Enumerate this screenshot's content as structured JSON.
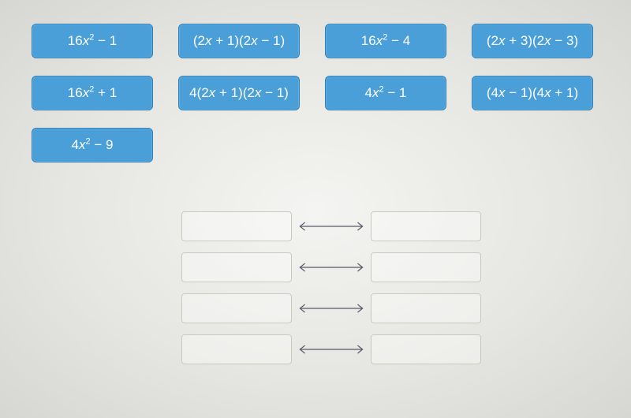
{
  "tiles": {
    "r0c0": {
      "pre": "16",
      "x": "x",
      "sup": "2",
      "post": " − 1"
    },
    "r0c1": {
      "plain": "(2",
      "x1": "x",
      "mid": " + 1)(2",
      "x2": "x",
      "end": " − 1)"
    },
    "r0c2": {
      "pre": "16",
      "x": "x",
      "sup": "2",
      "post": " − 4"
    },
    "r0c3": {
      "plain": "(2",
      "x1": "x",
      "mid": " + 3)(2",
      "x2": "x",
      "end": " − 3)"
    },
    "r1c0": {
      "pre": "16",
      "x": "x",
      "sup": "2",
      "post": " + 1"
    },
    "r1c1": {
      "plain": "4(2",
      "x1": "x",
      "mid": " + 1)(2",
      "x2": "x",
      "end": " − 1)"
    },
    "r1c2": {
      "pre": "4",
      "x": "x",
      "sup": "2",
      "post": " − 1"
    },
    "r1c3": {
      "plain": "(4",
      "x1": "x",
      "mid": " − 1)(4",
      "x2": "x",
      "end": " + 1)"
    },
    "r2c0": {
      "pre": "4",
      "x": "x",
      "sup": "2",
      "post": " − 9"
    }
  },
  "match_slots": 4
}
